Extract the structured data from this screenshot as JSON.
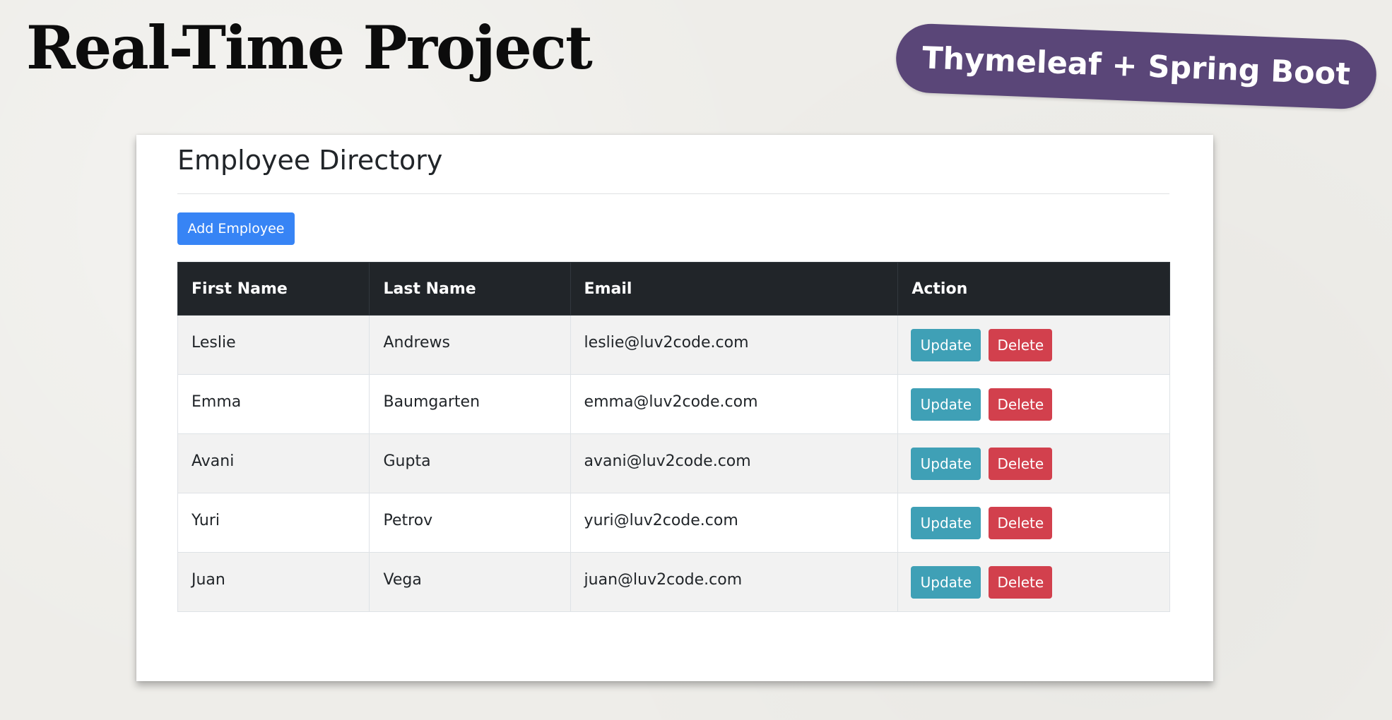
{
  "slide": {
    "title": "Real-Time Project",
    "tag": "Thymeleaf + Spring Boot"
  },
  "app": {
    "heading": "Employee Directory",
    "add_button_label": "Add Employee",
    "columns": [
      "First Name",
      "Last Name",
      "Email",
      "Action"
    ],
    "rows": [
      {
        "first_name": "Leslie",
        "last_name": "Andrews",
        "email": "leslie@luv2code.com",
        "update_label": "Update",
        "delete_label": "Delete"
      },
      {
        "first_name": "Emma",
        "last_name": "Baumgarten",
        "email": "emma@luv2code.com",
        "update_label": "Update",
        "delete_label": "Delete"
      },
      {
        "first_name": "Avani",
        "last_name": "Gupta",
        "email": "avani@luv2code.com",
        "update_label": "Update",
        "delete_label": "Delete"
      },
      {
        "first_name": "Yuri",
        "last_name": "Petrov",
        "email": "yuri@luv2code.com",
        "update_label": "Update",
        "delete_label": "Delete"
      },
      {
        "first_name": "Juan",
        "last_name": "Vega",
        "email": "juan@luv2code.com",
        "update_label": "Update",
        "delete_label": "Delete"
      }
    ]
  },
  "colors": {
    "tag_background": "#5a4678",
    "primary_button": "#3784f5",
    "info_button": "#3fa0b6",
    "danger_button": "#d2404d",
    "table_header": "#212529",
    "striped_row": "#f2f2f2"
  }
}
